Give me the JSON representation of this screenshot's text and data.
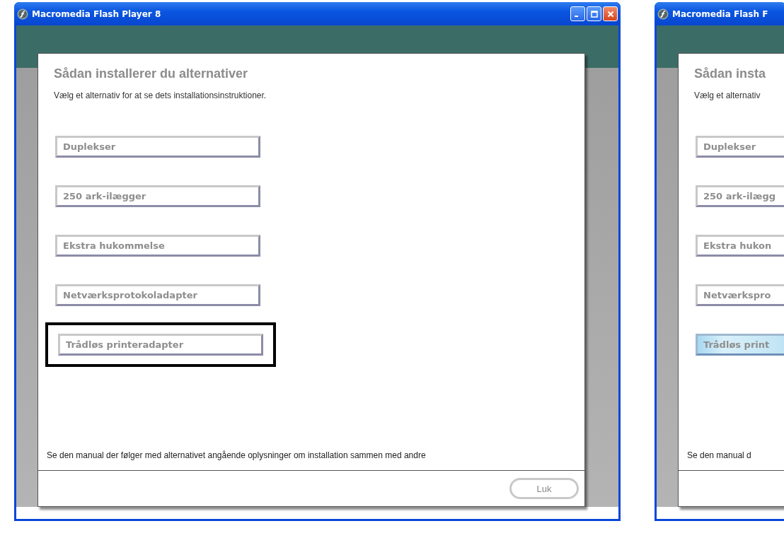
{
  "windows": [
    {
      "title": "Macromedia Flash Player 8",
      "window_controls": true,
      "heading": "Sådan installerer du alternativer",
      "instruction": "Vælg et alternativ for at se dets installationsinstruktioner.",
      "options": [
        {
          "label": "Duplekser",
          "hovered": false,
          "outlined": false
        },
        {
          "label": "250 ark-ilægger",
          "hovered": false,
          "outlined": false
        },
        {
          "label": "Ekstra hukommelse",
          "hovered": false,
          "outlined": false
        },
        {
          "label": "Netværksprotokoladapter",
          "hovered": false,
          "outlined": false
        },
        {
          "label": "Trådløs printeradapter",
          "hovered": false,
          "outlined": true
        }
      ],
      "note": "Se den manual der følger med alternativet angående oplysninger om installation sammen med andre",
      "close_button": "Luk"
    },
    {
      "title": "Macromedia Flash F",
      "window_controls": false,
      "heading": "Sådan insta",
      "instruction": "Vælg et alternativ",
      "options": [
        {
          "label": "Duplekser",
          "hovered": false,
          "outlined": false
        },
        {
          "label": "250 ark-ilægg",
          "hovered": false,
          "outlined": false
        },
        {
          "label": "Ekstra hukon",
          "hovered": false,
          "outlined": false
        },
        {
          "label": "Netværkspro",
          "hovered": false,
          "outlined": false
        },
        {
          "label": "Trådløs print",
          "hovered": true,
          "outlined": false
        }
      ],
      "note": "Se den manual d"
    }
  ]
}
